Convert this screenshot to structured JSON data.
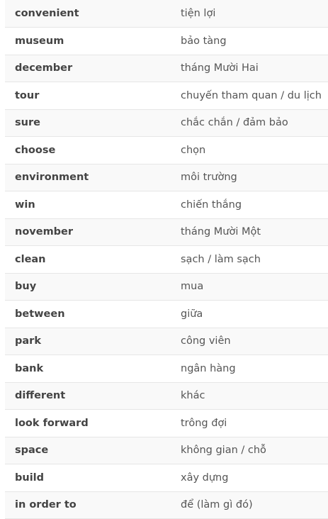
{
  "vocabulary": [
    {
      "term": "convenient",
      "meaning": "tiện lợi"
    },
    {
      "term": "museum",
      "meaning": "bảo tàng"
    },
    {
      "term": "december",
      "meaning": "tháng Mười Hai"
    },
    {
      "term": "tour",
      "meaning": "chuyến tham quan / du lịch"
    },
    {
      "term": "sure",
      "meaning": "chắc chắn / đảm bảo"
    },
    {
      "term": "choose",
      "meaning": "chọn"
    },
    {
      "term": "environment",
      "meaning": "môi trường"
    },
    {
      "term": "win",
      "meaning": "chiến thắng"
    },
    {
      "term": "november",
      "meaning": "tháng Mười Một"
    },
    {
      "term": "clean",
      "meaning": "sạch / làm sạch"
    },
    {
      "term": "buy",
      "meaning": "mua"
    },
    {
      "term": "between",
      "meaning": "giữa"
    },
    {
      "term": "park",
      "meaning": "công viên"
    },
    {
      "term": "bank",
      "meaning": "ngân hàng"
    },
    {
      "term": "different",
      "meaning": "khác"
    },
    {
      "term": "look forward",
      "meaning": "trông đợi"
    },
    {
      "term": "space",
      "meaning": "không gian / chỗ"
    },
    {
      "term": "build",
      "meaning": "xây dựng"
    },
    {
      "term": "in order to",
      "meaning": "để (làm gì đó)"
    }
  ]
}
